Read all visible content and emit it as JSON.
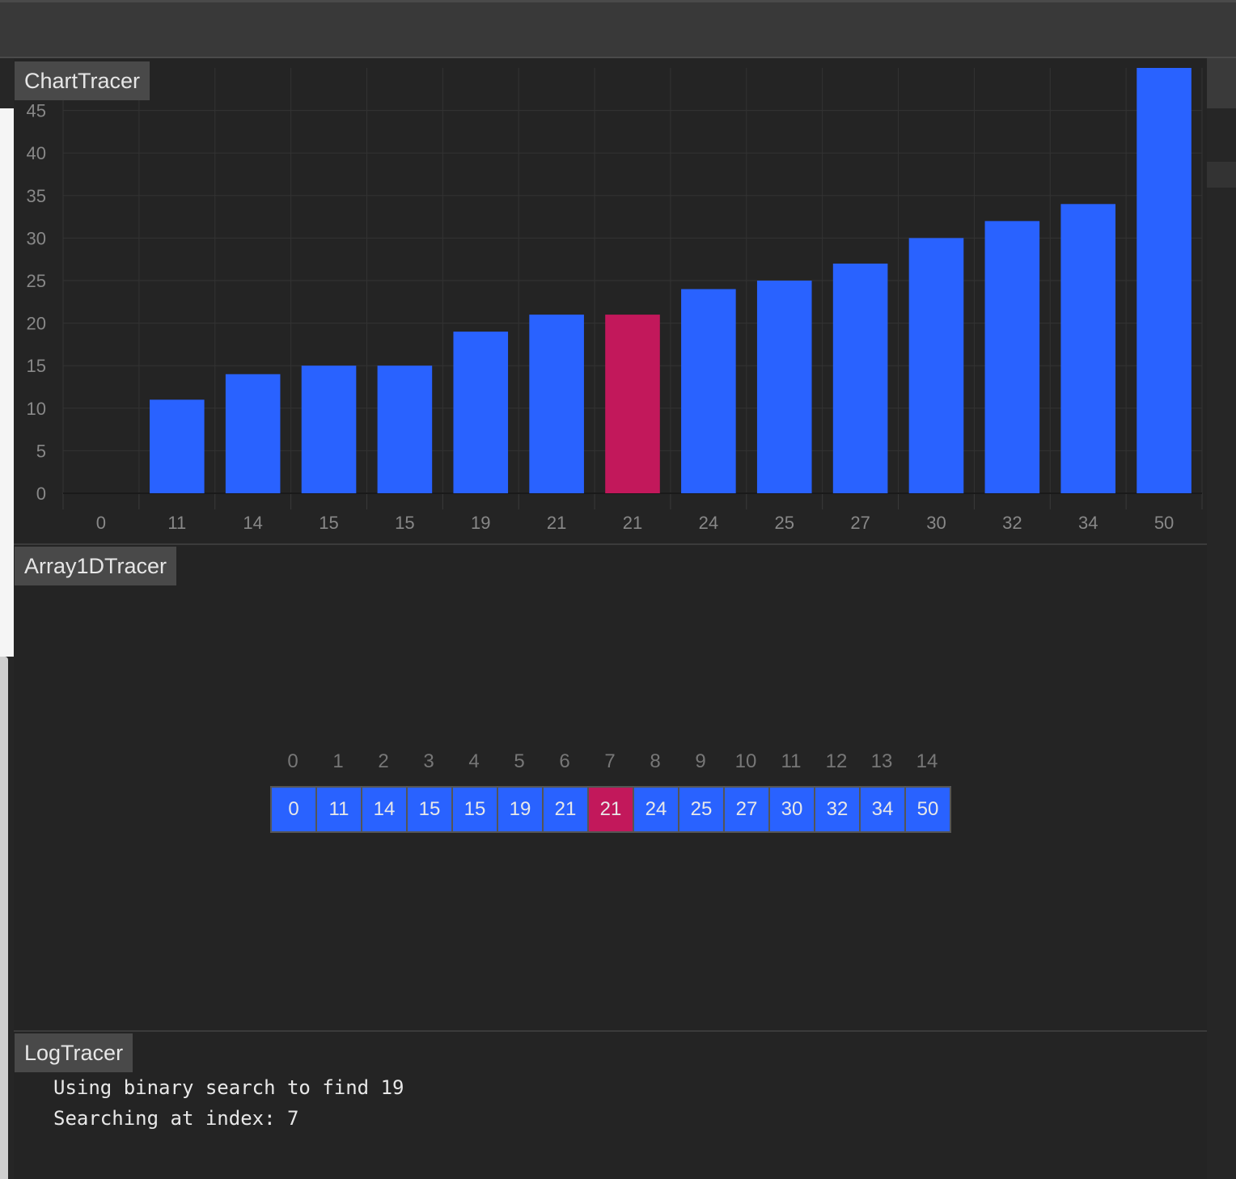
{
  "panels": {
    "chart": {
      "title": "ChartTracer"
    },
    "array": {
      "title": "Array1DTracer"
    },
    "log": {
      "title": "LogTracer"
    }
  },
  "chart_data": {
    "type": "bar",
    "categories": [
      "0",
      "11",
      "14",
      "15",
      "15",
      "19",
      "21",
      "21",
      "24",
      "25",
      "27",
      "30",
      "32",
      "34",
      "50"
    ],
    "values": [
      0,
      11,
      14,
      15,
      15,
      19,
      21,
      21,
      24,
      25,
      27,
      30,
      32,
      34,
      50
    ],
    "highlight_index": 7,
    "yticks": [
      0,
      5,
      10,
      15,
      20,
      25,
      30,
      35,
      40,
      45
    ],
    "ylim": [
      0,
      50
    ],
    "grid": true,
    "colors": {
      "bar": "#2962ff",
      "highlight": "#c2185b",
      "grid": "#333333",
      "tick": "#888888"
    }
  },
  "array": {
    "indices": [
      "0",
      "1",
      "2",
      "3",
      "4",
      "5",
      "6",
      "7",
      "8",
      "9",
      "10",
      "11",
      "12",
      "13",
      "14"
    ],
    "values": [
      "0",
      "11",
      "14",
      "15",
      "15",
      "19",
      "21",
      "21",
      "24",
      "25",
      "27",
      "30",
      "32",
      "34",
      "50"
    ],
    "highlight_index": 7
  },
  "log": {
    "lines": [
      "Using binary search to find 19",
      "Searching at index: 7"
    ]
  }
}
